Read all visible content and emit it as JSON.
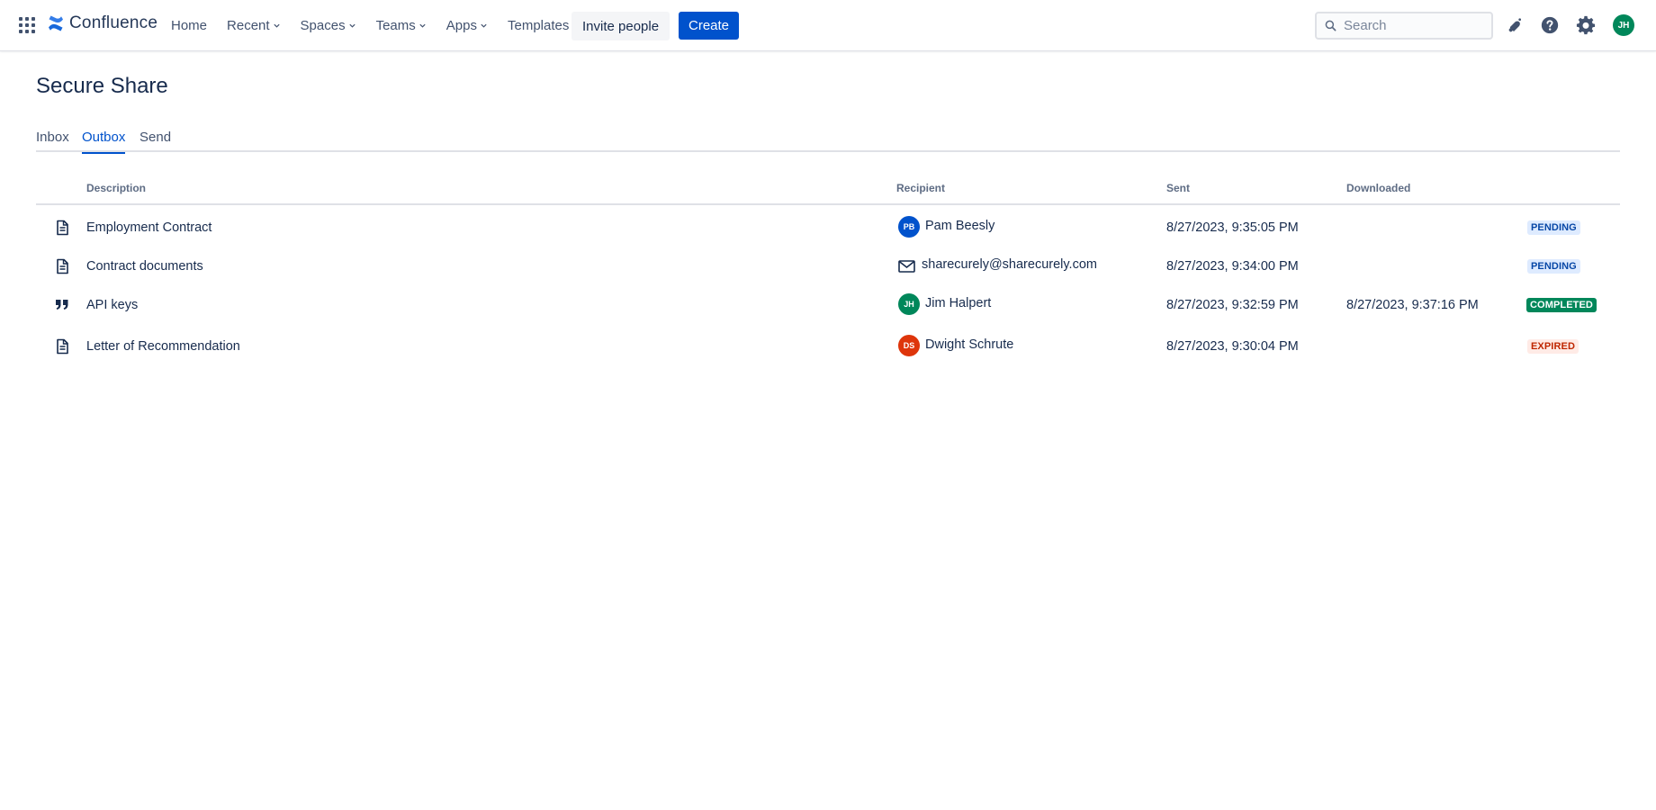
{
  "app": {
    "name": "Confluence"
  },
  "colors": {
    "brand": "#0052cc",
    "text": "#172b4d",
    "muted": "#5e6c84"
  },
  "nav": {
    "items": [
      {
        "label": "Home",
        "dropdown": false
      },
      {
        "label": "Recent",
        "dropdown": true
      },
      {
        "label": "Spaces",
        "dropdown": true
      },
      {
        "label": "Teams",
        "dropdown": true
      },
      {
        "label": "Apps",
        "dropdown": true
      },
      {
        "label": "Templates",
        "dropdown": false
      }
    ],
    "invite_label": "Invite people",
    "create_label": "Create",
    "search_placeholder": "Search",
    "icons": [
      "notifications-icon",
      "help-icon",
      "settings-icon"
    ],
    "user_initials": "JH"
  },
  "page": {
    "title": "Secure Share",
    "tabs": [
      {
        "label": "Inbox",
        "active": false
      },
      {
        "label": "Outbox",
        "active": true
      },
      {
        "label": "Send",
        "active": false
      }
    ]
  },
  "table": {
    "headers": {
      "description": "Description",
      "recipient": "Recipient",
      "sent": "Sent",
      "downloaded": "Downloaded"
    },
    "rows": [
      {
        "icon": "document-icon",
        "description": "Employment Contract",
        "recipient": {
          "type": "user",
          "initials": "PB",
          "name": "Pam Beesly",
          "color": "#0052cc"
        },
        "sent": "8/27/2023, 9:35:05 PM",
        "downloaded": "",
        "status": {
          "label": "PENDING",
          "bg": "#deebff",
          "fg": "#0747a6"
        }
      },
      {
        "icon": "document-icon",
        "description": "Contract documents",
        "recipient": {
          "type": "email",
          "name": "sharecurely@sharecurely.com"
        },
        "sent": "8/27/2023, 9:34:00 PM",
        "downloaded": "",
        "status": {
          "label": "PENDING",
          "bg": "#deebff",
          "fg": "#0747a6"
        }
      },
      {
        "icon": "quote-icon",
        "description": "API keys",
        "recipient": {
          "type": "user",
          "initials": "JH",
          "name": "Jim Halpert",
          "color": "#00875a"
        },
        "sent": "8/27/2023, 9:32:59 PM",
        "downloaded": "8/27/2023, 9:37:16 PM",
        "status": {
          "label": "COMPLETED",
          "bg": "#00875a",
          "fg": "#ffffff"
        }
      },
      {
        "icon": "document-icon",
        "description": "Letter of Recommendation",
        "recipient": {
          "type": "user",
          "initials": "DS",
          "name": "Dwight Schrute",
          "color": "#de350b"
        },
        "sent": "8/27/2023, 9:30:04 PM",
        "downloaded": "",
        "status": {
          "label": "EXPIRED",
          "bg": "#ffebe6",
          "fg": "#bf2600"
        }
      }
    ]
  }
}
